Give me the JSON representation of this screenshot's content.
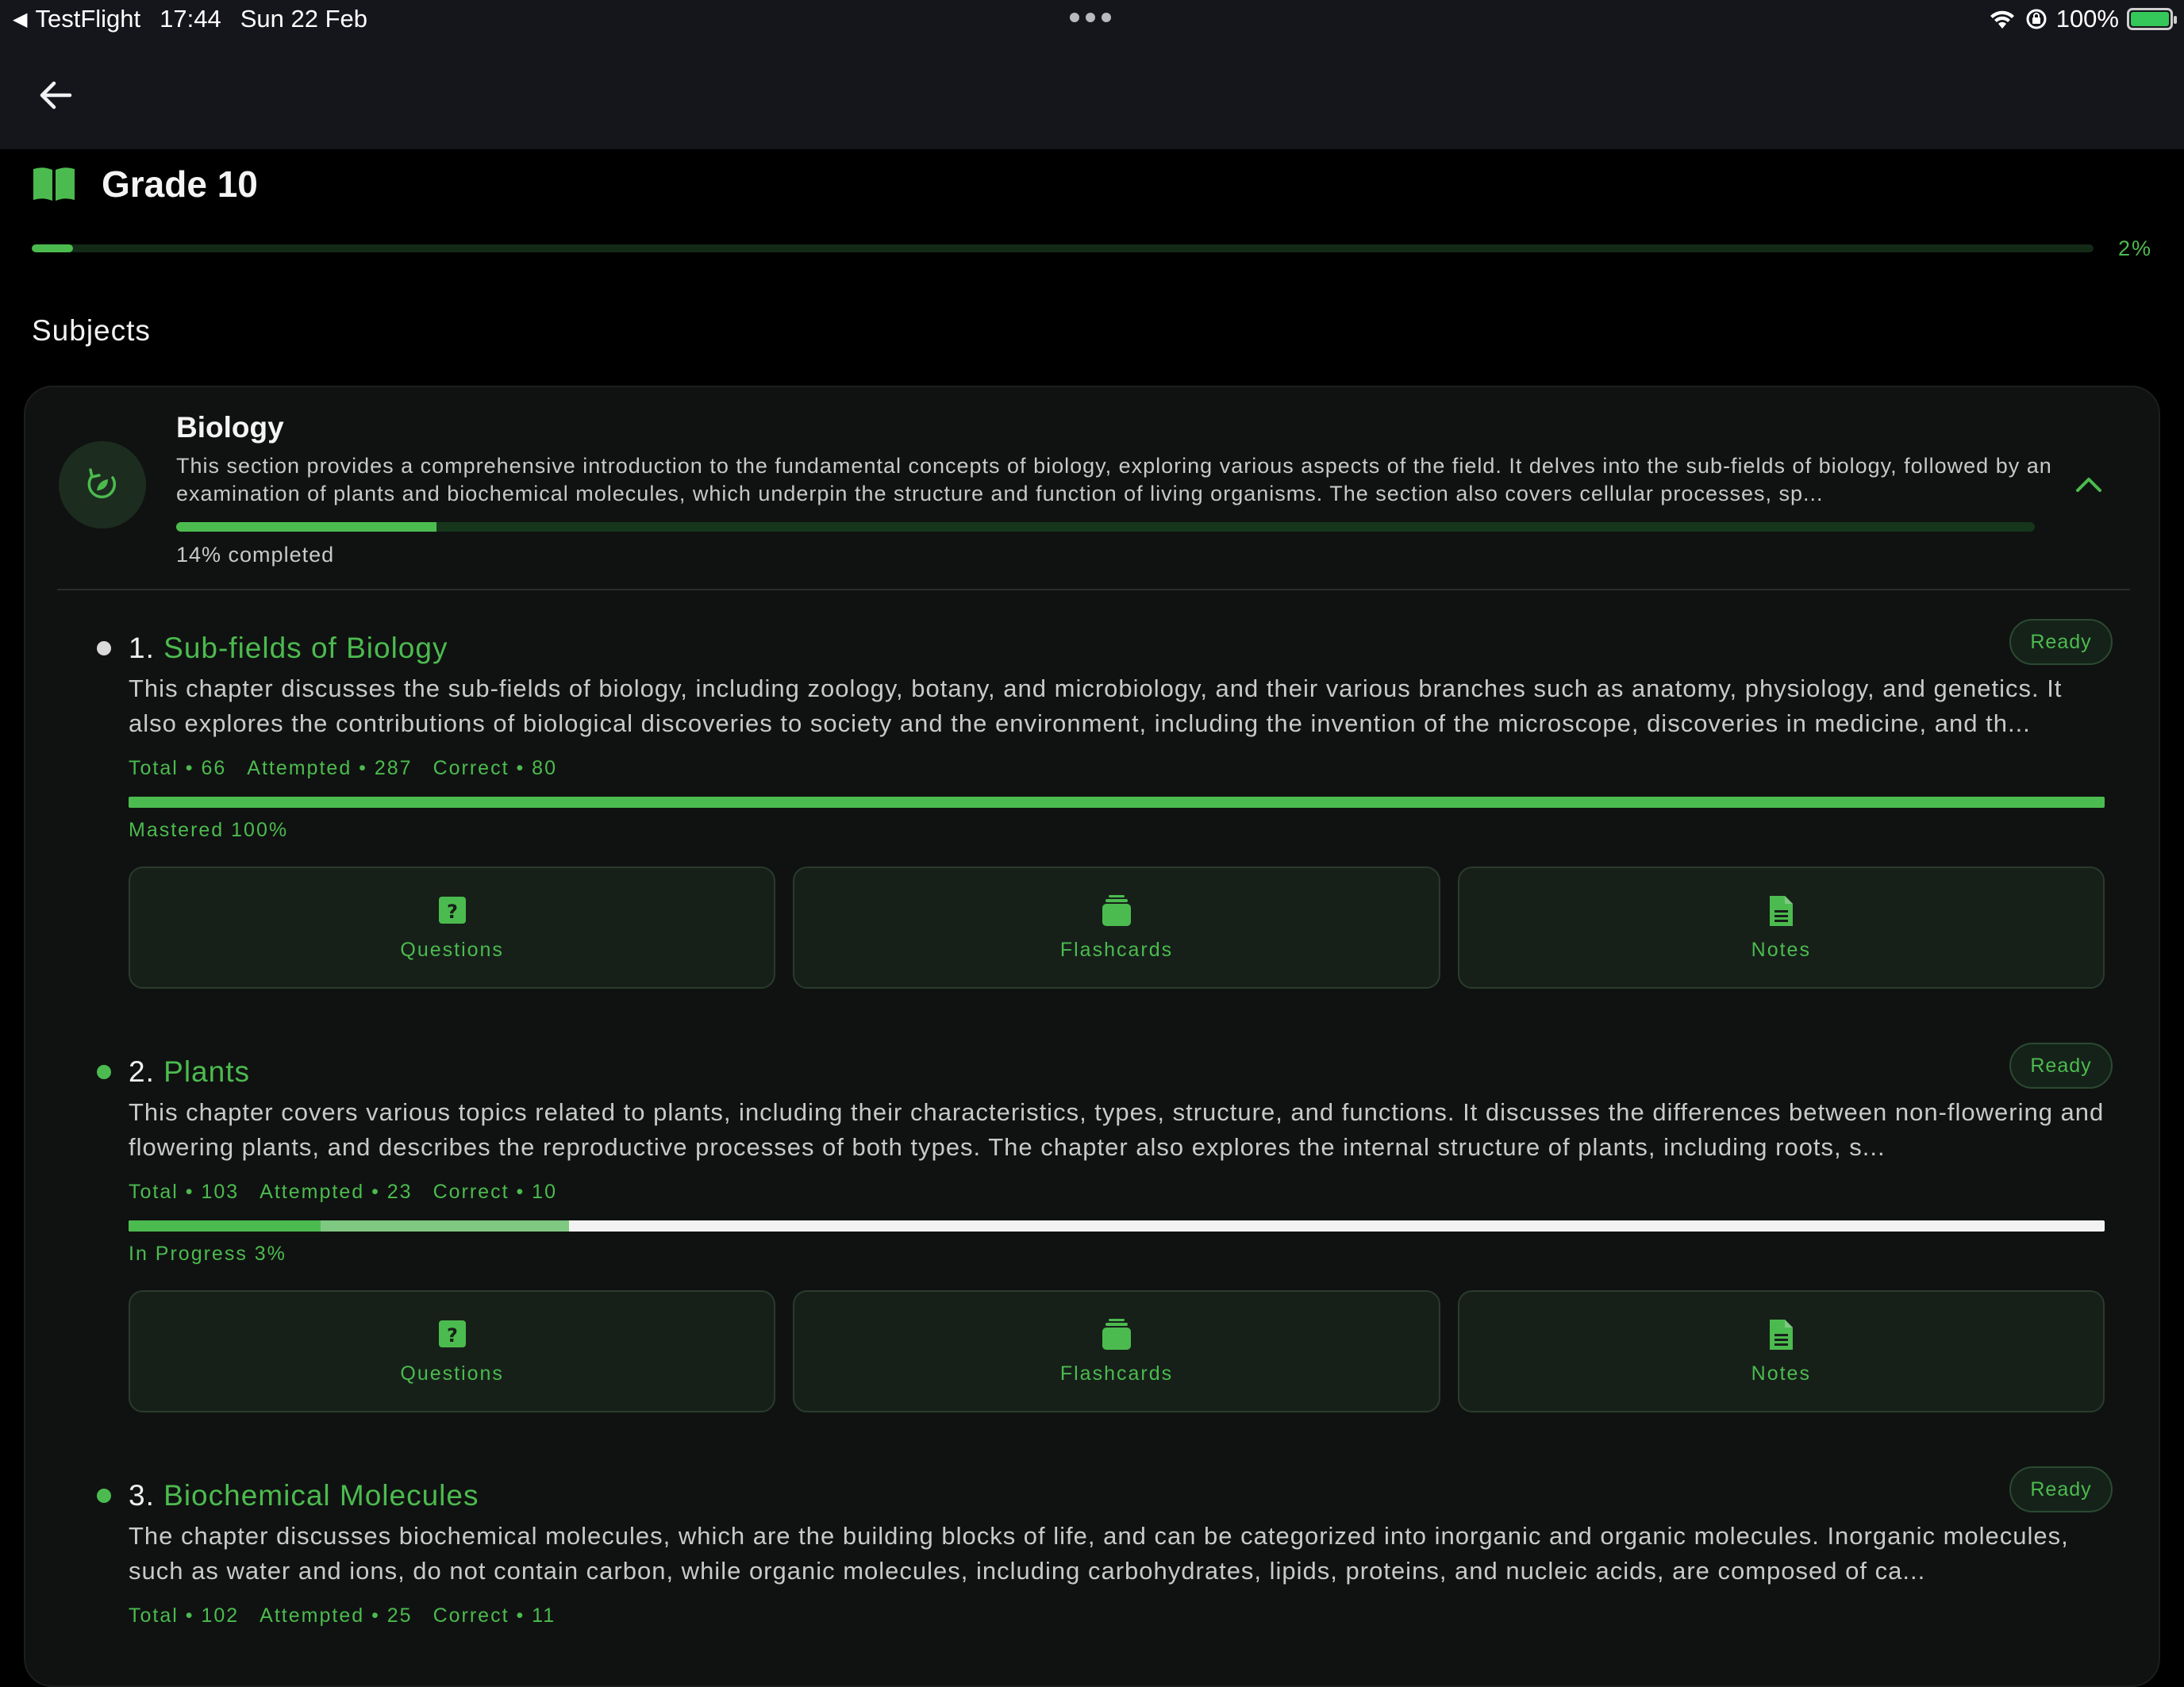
{
  "status_bar": {
    "back_app": "TestFlight",
    "time": "17:44",
    "date": "Sun 22 Feb",
    "battery": "100%"
  },
  "header": {
    "title": "Grade 10",
    "progress_percent": 2,
    "progress_label": "2%"
  },
  "section_title": "Subjects",
  "subject": {
    "name": "Biology",
    "description": "This  section provides a comprehensive introduction to the fundamental concepts of biology, exploring various aspects of the field. It delves into the sub-fields of biology, followed by an examination of plants and biochemical molecules, which underpin the structure and function of living organisms. The section also covers cellular processes, sp...",
    "progress_percent": 14,
    "progress_label": "14% completed"
  },
  "chapters": [
    {
      "number": "1.",
      "title": "Sub-fields of Biology",
      "badge": "Ready",
      "description": "This chapter discusses the sub-fields of biology, including zoology, botany, and microbiology, and their various branches such as anatomy, physiology, and genetics. It also explores the contributions of biological discoveries to society and the environment, including the invention of the microscope, discoveries in medicine, and th...",
      "stats": {
        "total": "Total • 66",
        "attempted": "Attempted • 287",
        "correct": "Correct • 80"
      },
      "status": "Mastered 100%",
      "progress_solid": 100,
      "progress_light": 0,
      "actions": [
        "Questions",
        "Flashcards",
        "Notes"
      ]
    },
    {
      "number": "2.",
      "title": "Plants",
      "badge": "Ready",
      "description": "This chapter covers various topics related to plants, including their characteristics, types, structure, and functions. It discusses the differences between non-flowering and flowering plants, and describes the reproductive processes of both types. The chapter also explores the internal structure of plants, including roots, s...",
      "stats": {
        "total": "Total • 103",
        "attempted": "Attempted • 23",
        "correct": "Correct • 10"
      },
      "status": "In Progress 3%",
      "progress_solid": 9.7,
      "progress_light": 12.6,
      "actions": [
        "Questions",
        "Flashcards",
        "Notes"
      ]
    },
    {
      "number": "3.",
      "title": "Biochemical Molecules",
      "badge": "Ready",
      "description": "The chapter discusses biochemical molecules, which are the building blocks of life, and can be categorized into inorganic and organic molecules. Inorganic molecules, such as water and ions, do not contain carbon, while organic molecules, including carbohydrates, lipids, proteins, and nucleic acids, are composed of ca...",
      "stats": {
        "total": "Total • 102",
        "attempted": "Attempted • 25",
        "correct": "Correct • 11"
      }
    }
  ],
  "colors": {
    "accent": "#4cbb4f",
    "background": "#000000",
    "card": "#101211"
  }
}
